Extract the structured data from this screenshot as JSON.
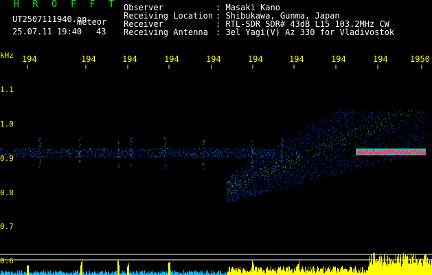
{
  "header": {
    "app_title": "H R O F F T",
    "file_name": "UT2507111940.pn",
    "meteor_label": "meteor",
    "date_time": "25.07.11 19:40",
    "meteor_count": "43"
  },
  "info": [
    {
      "key": "Observer",
      "value": ": Masaki Kano"
    },
    {
      "key": "Receiving Location",
      "value": ": Shibukawa, Gunma, Japan"
    },
    {
      "key": "Receiver",
      "value": ": RTL-SDR SDR# 43dB L15 103.2MHz CW"
    },
    {
      "key": "Receiving Antenna",
      "value": ": 3el Yagi(V) Az 330 for Vladivostok"
    }
  ],
  "freq_axis": {
    "unit": "kHz",
    "labels": [
      "1.1",
      "1.0",
      "0.9",
      "0.8",
      "0.7",
      "0.6"
    ]
  },
  "time_axis": {
    "labels": [
      "194",
      "194",
      "194",
      "194",
      "194",
      "194",
      "194",
      "194",
      "194",
      "1950"
    ]
  },
  "colors": {
    "background": "#000000",
    "text": "#ffffff",
    "axis": "#ffff00",
    "title": "#00ff00",
    "signal_low": "#1030c0",
    "signal_mid": "#20c0a0",
    "signal_high": "#ff3a7a",
    "echo_bars": "#ffff00",
    "noise_bars": "#00c0ff"
  }
}
